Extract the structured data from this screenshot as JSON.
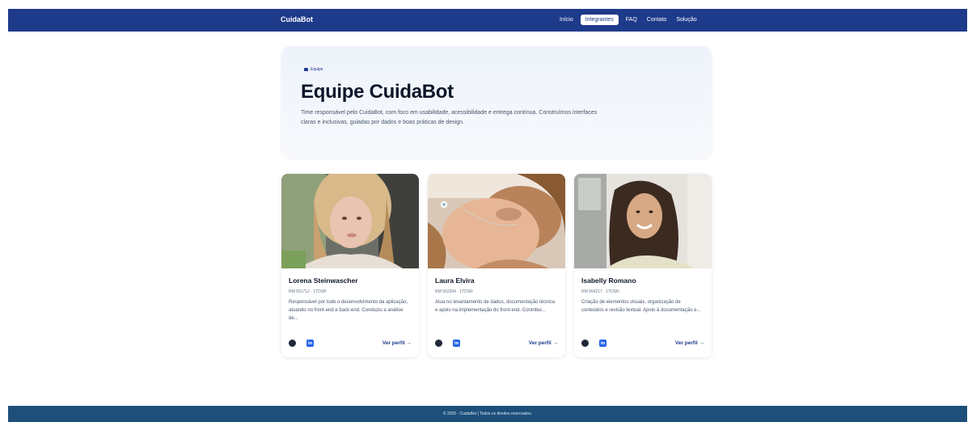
{
  "header": {
    "brand": "CuidaBot",
    "nav": [
      {
        "label": "Início",
        "active": false
      },
      {
        "label": "Integrantes",
        "active": true
      },
      {
        "label": "FAQ",
        "active": false
      },
      {
        "label": "Contato",
        "active": false
      },
      {
        "label": "Solução",
        "active": false
      }
    ]
  },
  "hero": {
    "tag": "Equipe",
    "title": "Equipe CuidaBot",
    "description": "Time responsável pelo CuidaBot, com foco em usabilidade, acessibilidade e entrega contínua. Construímos interfaces claras e inclusivas, guiadas por dados e boas práticas de design."
  },
  "members": [
    {
      "name": "Lorena Steinwascher",
      "rm": "RM 561712 · 1TDSR",
      "description": "Responsável por todo o desenvolvimento da aplicação, atuando no front-end e back-end. Conduziu a análise de...",
      "link": "Ver perfil →"
    },
    {
      "name": "Laura Elvira",
      "rm": "RM 562204 · 1TDSR",
      "description": "Atua no levantamento de dados, documentação técnica e apoio na implementação do front-end. Contribui...",
      "link": "Ver perfil →"
    },
    {
      "name": "Isabelly Romano",
      "rm": "RM 564217 · 1TDSR",
      "description": "Criação de elementos visuais, organização de conteúdos e revisão textual. Apoio à documentação e...",
      "link": "Ver perfil →"
    }
  ],
  "icons": {
    "github": "github-icon",
    "linkedin": "linkedin-icon",
    "linkedin_glyph": "in"
  },
  "colors": {
    "header": "#1e3a8a",
    "footer": "#1d4f7a",
    "accent": "#1e3a8a",
    "linkedin": "#2563eb"
  },
  "footer": {
    "text": "© 2025 - CuidaBot | Todos os direitos reservados."
  }
}
